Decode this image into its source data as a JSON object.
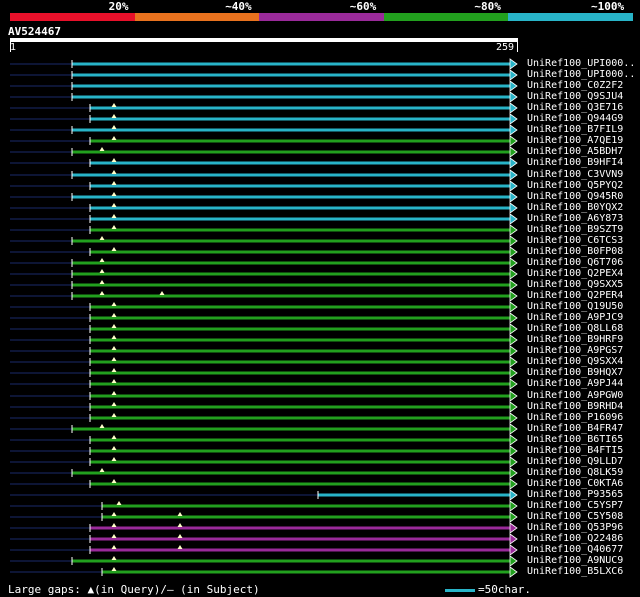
{
  "identity_legend": [
    {
      "label": "20%",
      "color": "#e8102a"
    },
    {
      "label": "~40%",
      "color": "#e8721e"
    },
    {
      "label": "~60%",
      "color": "#9a2a9a"
    },
    {
      "label": "~80%",
      "color": "#22a01e"
    },
    {
      "label": "~100%",
      "color": "#28b4c8"
    }
  ],
  "query": {
    "name": "AV524467",
    "start": "1",
    "end": "259"
  },
  "hits": [
    {
      "label": "UniRef100_UPI000..",
      "color": "#28b4c8"
    },
    {
      "label": "UniRef100_UPI000..",
      "color": "#28b4c8"
    },
    {
      "label": "UniRef100_C0Z2F2",
      "color": "#28b4c8"
    },
    {
      "label": "UniRef100_Q9SJU4",
      "color": "#28b4c8"
    },
    {
      "label": "UniRef100_Q3E716",
      "color": "#28b4c8"
    },
    {
      "label": "UniRef100_Q944G9",
      "color": "#28b4c8"
    },
    {
      "label": "UniRef100_B7FIL9",
      "color": "#28b4c8"
    },
    {
      "label": "UniRef100_A7QE19",
      "color": "#22a01e"
    },
    {
      "label": "UniRef100_A5BDH7",
      "color": "#22a01e"
    },
    {
      "label": "UniRef100_B9HFI4",
      "color": "#28b4c8"
    },
    {
      "label": "UniRef100_C3VVN9",
      "color": "#28b4c8"
    },
    {
      "label": "UniRef100_Q5PYQ2",
      "color": "#28b4c8"
    },
    {
      "label": "UniRef100_Q945R0",
      "color": "#28b4c8"
    },
    {
      "label": "UniRef100_B0YQX2",
      "color": "#28b4c8"
    },
    {
      "label": "UniRef100_A6Y873",
      "color": "#28b4c8"
    },
    {
      "label": "UniRef100_B9SZT9",
      "color": "#22a01e"
    },
    {
      "label": "UniRef100_C6TCS3",
      "color": "#22a01e"
    },
    {
      "label": "UniRef100_B0FP08",
      "color": "#22a01e"
    },
    {
      "label": "UniRef100_Q6T706",
      "color": "#22a01e"
    },
    {
      "label": "UniRef100_Q2PEX4",
      "color": "#22a01e"
    },
    {
      "label": "UniRef100_Q9SXX5",
      "color": "#22a01e"
    },
    {
      "label": "UniRef100_Q2PER4",
      "color": "#22a01e"
    },
    {
      "label": "UniRef100_Q19U50",
      "color": "#22a01e"
    },
    {
      "label": "UniRef100_A9PJC9",
      "color": "#22a01e"
    },
    {
      "label": "UniRef100_Q8LL68",
      "color": "#22a01e"
    },
    {
      "label": "UniRef100_B9HRF9",
      "color": "#22a01e"
    },
    {
      "label": "UniRef100_A9PGS7",
      "color": "#22a01e"
    },
    {
      "label": "UniRef100_Q9SXX4",
      "color": "#22a01e"
    },
    {
      "label": "UniRef100_B9HQX7",
      "color": "#22a01e"
    },
    {
      "label": "UniRef100_A9PJ44",
      "color": "#22a01e"
    },
    {
      "label": "UniRef100_A9PGW0",
      "color": "#22a01e"
    },
    {
      "label": "UniRef100_B9RHD4",
      "color": "#22a01e"
    },
    {
      "label": "UniRef100_P16096",
      "color": "#22a01e"
    },
    {
      "label": "UniRef100_B4FR47",
      "color": "#22a01e"
    },
    {
      "label": "UniRef100_B6TI65",
      "color": "#22a01e"
    },
    {
      "label": "UniRef100_B4FTI5",
      "color": "#22a01e"
    },
    {
      "label": "UniRef100_Q9LLD7",
      "color": "#22a01e"
    },
    {
      "label": "UniRef100_Q8LK59",
      "color": "#22a01e"
    },
    {
      "label": "UniRef100_C0KTA6",
      "color": "#22a01e"
    },
    {
      "label": "UniRef100_P93565",
      "color": "#28b4c8"
    },
    {
      "label": "UniRef100_C5YSP7",
      "color": "#22a01e"
    },
    {
      "label": "UniRef100_C5Y508",
      "color": "#22a01e"
    },
    {
      "label": "UniRef100_Q53P96",
      "color": "#9a2a9a"
    },
    {
      "label": "UniRef100_Q22486",
      "color": "#9a2a9a"
    },
    {
      "label": "UniRef100_Q40677",
      "color": "#9a2a9a"
    },
    {
      "label": "UniRef100_A9NUC9",
      "color": "#22a01e"
    },
    {
      "label": "UniRef100_B5LXC6",
      "color": "#22a01e"
    }
  ],
  "footer": {
    "text": "Large gaps: ▲(in Query)/– (in Subject)",
    "scale": "=50char."
  }
}
